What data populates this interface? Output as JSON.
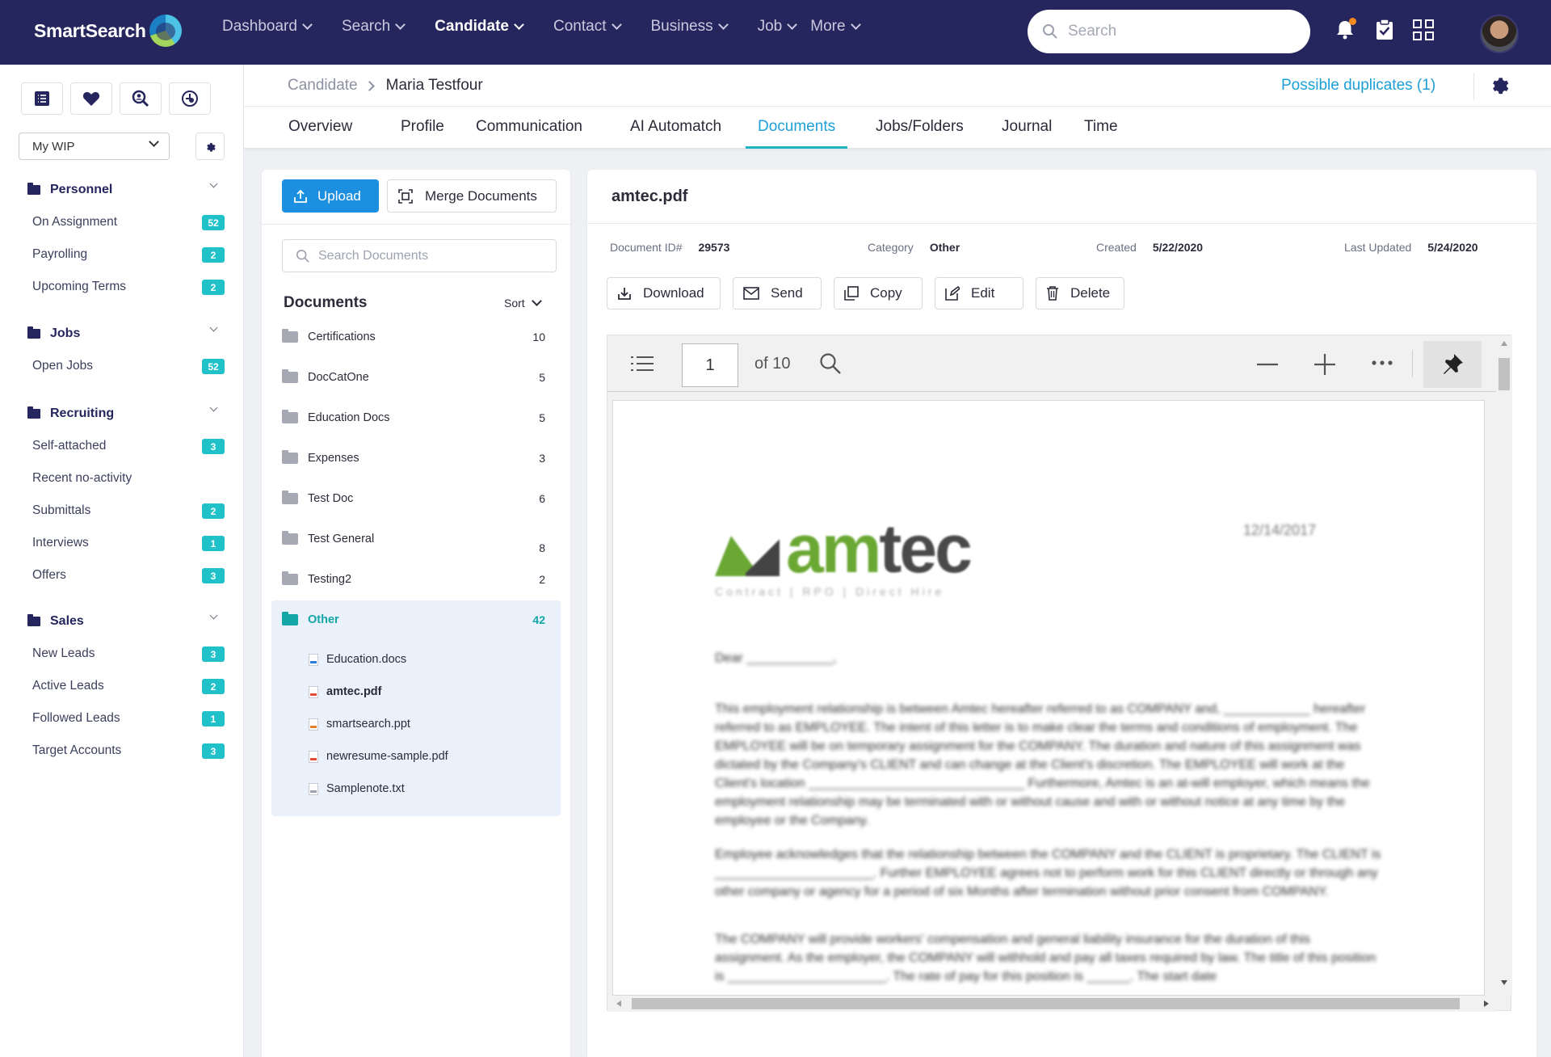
{
  "app": {
    "brand": "SmartSearch"
  },
  "nav": {
    "items": [
      {
        "label": "Dashboard"
      },
      {
        "label": "Search"
      },
      {
        "label": "Candidate"
      },
      {
        "label": "Contact"
      },
      {
        "label": "Business"
      },
      {
        "label": "Job"
      },
      {
        "label": "More"
      }
    ],
    "active": "Candidate"
  },
  "search": {
    "placeholder": "Search"
  },
  "sidebar": {
    "wip_select": "My WIP",
    "sections": [
      {
        "title": "Personnel",
        "items": [
          {
            "label": "On Assignment",
            "badge": "52"
          },
          {
            "label": "Payrolling",
            "badge": "2"
          },
          {
            "label": "Upcoming Terms",
            "badge": "2"
          }
        ]
      },
      {
        "title": "Jobs",
        "items": [
          {
            "label": "Open Jobs",
            "badge": "52"
          }
        ]
      },
      {
        "title": "Recruiting",
        "items": [
          {
            "label": "Self-attached",
            "badge": "3"
          },
          {
            "label": "Recent no-activity",
            "badge": ""
          },
          {
            "label": "Submittals",
            "badge": "2"
          },
          {
            "label": "Interviews",
            "badge": "1"
          },
          {
            "label": "Offers",
            "badge": "3"
          }
        ]
      },
      {
        "title": "Sales",
        "items": [
          {
            "label": "New Leads",
            "badge": "3"
          },
          {
            "label": "Active Leads",
            "badge": "2"
          },
          {
            "label": "Followed Leads",
            "badge": "1"
          },
          {
            "label": "Target Accounts",
            "badge": "3"
          }
        ]
      }
    ]
  },
  "breadcrumb": {
    "parent": "Candidate",
    "current": "Maria Testfour",
    "duplicates": "Possible duplicates (1)"
  },
  "tabs": [
    {
      "label": "Overview"
    },
    {
      "label": "Profile"
    },
    {
      "label": "Communication"
    },
    {
      "label": "AI Automatch"
    },
    {
      "label": "Documents"
    },
    {
      "label": "Jobs/Folders"
    },
    {
      "label": "Journal"
    },
    {
      "label": "Time"
    }
  ],
  "active_tab": "Documents",
  "documents": {
    "upload_label": "Upload",
    "merge_label": "Merge Documents",
    "search_placeholder": "Search Documents",
    "title": "Documents",
    "sort_label": "Sort",
    "folders": [
      {
        "name": "Certifications",
        "count": "10"
      },
      {
        "name": "DocCatOne",
        "count": "5"
      },
      {
        "name": "Education Docs",
        "count": "5"
      },
      {
        "name": "Expenses",
        "count": "3"
      },
      {
        "name": "Test Doc",
        "count": "6"
      },
      {
        "name": "Test General",
        "count": "8"
      },
      {
        "name": "Testing2",
        "count": "2"
      }
    ],
    "open_folder": {
      "name": "Other",
      "count": "42"
    },
    "files": [
      {
        "name": "Education.docs",
        "type": "doc"
      },
      {
        "name": "amtec.pdf",
        "type": "pdf"
      },
      {
        "name": "smartsearch.ppt",
        "type": "ppt"
      },
      {
        "name": "newresume-sample.pdf",
        "type": "pdf"
      },
      {
        "name": "Samplenote.txt",
        "type": "txt"
      }
    ],
    "selected_file": "amtec.pdf"
  },
  "preview": {
    "title": "amtec.pdf",
    "meta": {
      "id_label": "Document ID#",
      "id_value": "29573",
      "category_label": "Category",
      "category_value": "Other",
      "created_label": "Created",
      "created_value": "5/22/2020",
      "updated_label": "Last Updated",
      "updated_value": "5/24/2020"
    },
    "actions": [
      {
        "label": "Download",
        "icon": "download-icon"
      },
      {
        "label": "Send",
        "icon": "mail-icon"
      },
      {
        "label": "Copy",
        "icon": "copy-icon"
      },
      {
        "label": "Edit",
        "icon": "edit-icon"
      },
      {
        "label": "Delete",
        "icon": "trash-icon"
      }
    ],
    "viewer": {
      "page_number": "1",
      "page_total": "of 10"
    },
    "pdf_content": {
      "logo_word_green": "am",
      "logo_word_dark": "tec",
      "logo_tagline": "Contract | RPO | Direct Hire",
      "date": "12/14/2017",
      "greeting": "Dear ____________,",
      "paragraph_1": "This employment relationship is between Amtec hereafter referred to as COMPANY and, ____________ hereafter referred to as EMPLOYEE. The intent of this letter is to make clear the terms and conditions of employment. The EMPLOYEE will be on temporary assignment for the COMPANY. The duration and nature of this assignment was dictated by the Company's CLIENT and can change at the Client's discretion. The EMPLOYEE will work at the Client's location ______________________________ Furthermore, Amtec is an at-will employer, which means the employment relationship may be terminated with or without cause and with or without notice at any time by the employee or the Company.",
      "paragraph_2": "Employee acknowledges that the relationship between the COMPANY and the CLIENT is proprietary. The CLIENT is ______________________. Further EMPLOYEE agrees not to perform work for this CLIENT directly or through any other company or agency for a period of six Months after termination without prior consent from COMPANY.",
      "paragraph_3": "The COMPANY will provide workers' compensation and general liability insurance for the duration of this assignment. As the employer, the COMPANY will withhold and pay all taxes required by law. The title of this position is ______________________. The rate of pay for this position is ______. The start date"
    }
  },
  "colors": {
    "topbar": "#26265e",
    "accent": "#1d9fd8",
    "badge": "#20c1c9",
    "upload_button": "#1d8fe0",
    "amtec_green": "#6aa833"
  }
}
